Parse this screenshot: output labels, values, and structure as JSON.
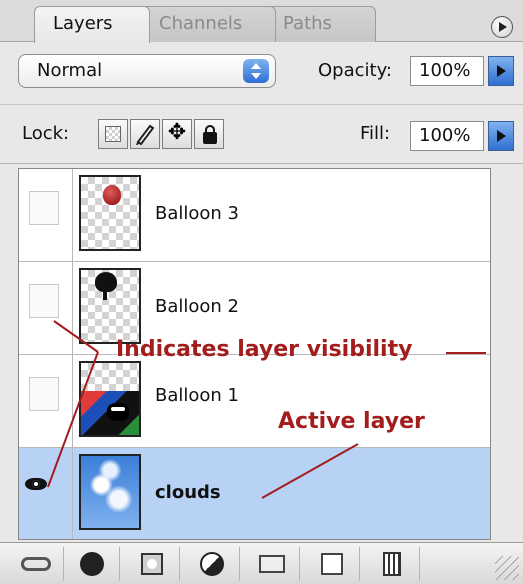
{
  "tabs": [
    {
      "label": "Layers",
      "active": true
    },
    {
      "label": "Channels",
      "active": false
    },
    {
      "label": "Paths",
      "active": false
    }
  ],
  "blend_mode": {
    "value": "Normal"
  },
  "opacity": {
    "label": "Opacity:",
    "value": "100%"
  },
  "lock": {
    "label": "Lock:"
  },
  "fill": {
    "label": "Fill:",
    "value": "100%"
  },
  "layers": [
    {
      "name": "Balloon 3",
      "visible": false,
      "selected": false,
      "thumbnail": "red-balloon"
    },
    {
      "name": "Balloon 2",
      "visible": false,
      "selected": false,
      "thumbnail": "black-balloon"
    },
    {
      "name": "Balloon 1",
      "visible": false,
      "selected": false,
      "thumbnail": "cow-scene"
    },
    {
      "name": "clouds",
      "visible": true,
      "selected": true,
      "thumbnail": "sky-clouds"
    }
  ],
  "annotations": {
    "visibility": "Indicates layer visibility",
    "active": "Active layer",
    "color": "#a31d1d"
  },
  "toolbar_icons": [
    "link-icon",
    "layer-style-icon",
    "layer-mask-icon",
    "adjustment-layer-icon",
    "folder-icon",
    "new-layer-icon",
    "trash-icon",
    "resize-grip-icon"
  ],
  "colors": {
    "selection": "#b8d2f5",
    "accent": "#2f6fd3"
  }
}
